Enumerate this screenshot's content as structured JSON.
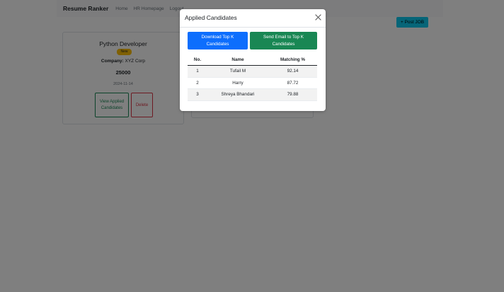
{
  "navbar": {
    "brand": "Resume Ranker",
    "links": [
      "Home",
      "HR Homepage",
      "Logout"
    ]
  },
  "post_job_label": "+ Post JOB",
  "job_card": {
    "title": "Python Developer",
    "badge": "New",
    "company_label": "Company:",
    "company_value": "XYZ Corp",
    "salary": "25000",
    "date": "2024-11-14",
    "view_label": "View Applied Candidates",
    "delete_label": "Delete"
  },
  "modal": {
    "title": "Applied Candidates",
    "download_label": "Download Top K Candidates",
    "email_label": "Send Email to Top K Candidates",
    "table": {
      "headers": [
        "No.",
        "Name",
        "Matching %"
      ],
      "rows": [
        {
          "no": "1",
          "name": "Tufail M",
          "match": "92.14"
        },
        {
          "no": "2",
          "name": "Harry",
          "match": "87.72"
        },
        {
          "no": "3",
          "name": "Shreya Bhandari",
          "match": "79.88"
        }
      ]
    }
  },
  "colors": {
    "primary": "#0d6efd",
    "success": "#198754",
    "danger": "#dc3545",
    "info": "#0dcaf0",
    "warning": "#ffc107"
  }
}
